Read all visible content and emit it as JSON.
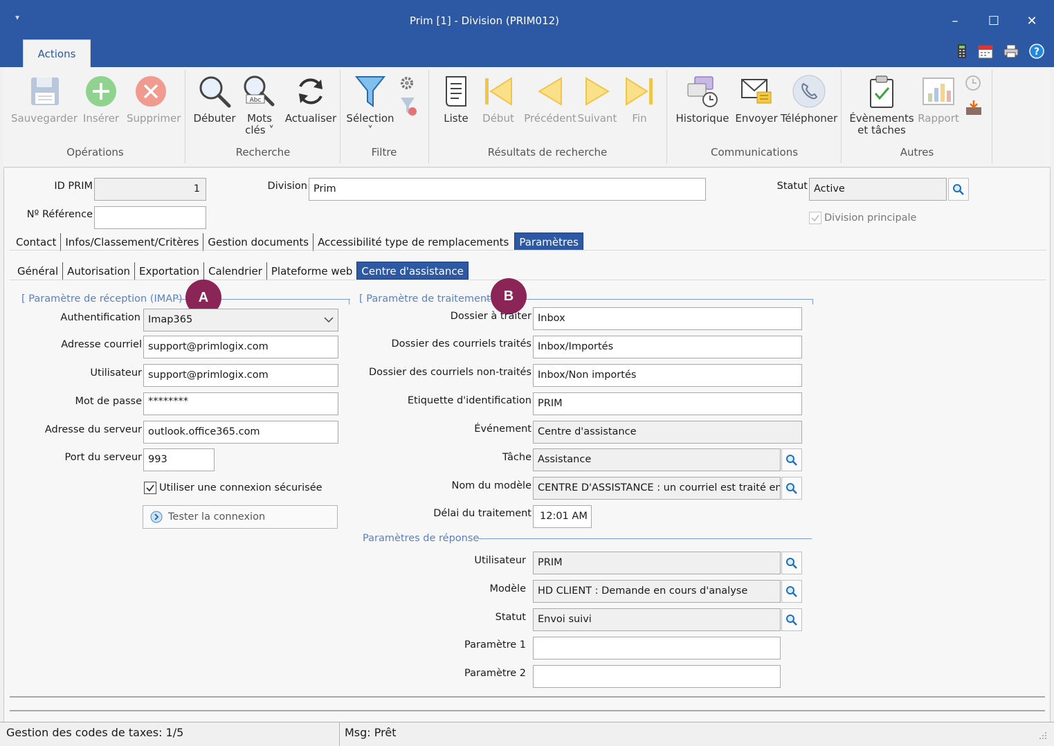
{
  "window": {
    "title": "Prim [1] - Division (PRIM012)",
    "minimize": "–",
    "maximize": "☐",
    "close": "✕"
  },
  "ribbon": {
    "tab": "Actions",
    "groups": {
      "operations": "Opérations",
      "recherche": "Recherche",
      "filtre": "Filtre",
      "resultats": "Résultats de recherche",
      "communications": "Communications",
      "autres": "Autres"
    },
    "buttons": {
      "sauvegarder": "Sauvegarder",
      "inserer": "Insérer",
      "supprimer": "Supprimer",
      "debuter": "Débuter",
      "mots_cles_1": "Mots",
      "mots_cles_2": "clés ˅",
      "actualiser": "Actualiser",
      "selection": "Sélection",
      "selection_arrow": "˅",
      "liste": "Liste",
      "debut": "Début",
      "precedent": "Précédent",
      "suivant": "Suivant",
      "fin": "Fin",
      "historique": "Historique",
      "envoyer": "Envoyer",
      "telephoner": "Téléphoner",
      "evenements_1": "Évènements",
      "evenements_2": "et tâches",
      "rapport": "Rapport"
    }
  },
  "header_fields": {
    "id_prim_label": "ID PRIM",
    "id_prim_value": "1",
    "division_label": "Division",
    "division_value": "Prim",
    "statut_label": "Statut",
    "statut_value": "Active",
    "reference_label": "Nº Référence",
    "reference_value": "",
    "division_principale_label": "Division principale"
  },
  "main_tabs": [
    "Contact",
    "Infos/Classement/Critères",
    "Gestion documents",
    "Accessibilité type de remplacements",
    "Paramètres"
  ],
  "sub_tabs": [
    "Général",
    "Autorisation",
    "Exportation",
    "Calendrier",
    "Plateforme web",
    "Centre d'assistance"
  ],
  "imap": {
    "section_title": "Paramètre de réception (IMAP)",
    "badge": "A",
    "auth_label": "Authentification",
    "auth_value": "Imap365",
    "email_label": "Adresse courriel",
    "email_value": "support@primlogix.com",
    "user_label": "Utilisateur",
    "user_value": "support@primlogix.com",
    "password_label": "Mot de passe",
    "password_value": "********",
    "server_label": "Adresse du serveur",
    "server_value": "outlook.office365.com",
    "port_label": "Port du serveur",
    "port_value": "993",
    "secure_label": "Utiliser une connexion sécurisée",
    "test_button": "Tester la connexion"
  },
  "traitement": {
    "section_title": "Paramètre de traitement",
    "badge": "B",
    "folder_label": "Dossier à traiter",
    "folder_value": "Inbox",
    "processed_label": "Dossier des courriels traités",
    "processed_value": "Inbox/Importés",
    "unprocessed_label": "Dossier des courriels non-traités",
    "unprocessed_value": "Inbox/Non importés",
    "tag_label": "Etiquette d'identification",
    "tag_value": "PRIM",
    "event_label": "Événement",
    "event_value": "Centre d'assistance",
    "task_label": "Tâche",
    "task_value": "Assistance",
    "template_label": "Nom du modèle",
    "template_value": "CENTRE D'ASSISTANCE : un courriel est traité en d",
    "delay_label": "Délai du traitement",
    "delay_value": "12:01 AM"
  },
  "reponse": {
    "section_title": "Paramètres de réponse",
    "user_label": "Utilisateur",
    "user_value": "PRIM",
    "model_label": "Modèle",
    "model_value": "HD CLIENT : Demande en cours d'analyse",
    "status_label": "Statut",
    "status_value": "Envoi suivi",
    "param1_label": "Paramètre 1",
    "param1_value": "",
    "param2_label": "Paramètre 2",
    "param2_value": ""
  },
  "statusbar": {
    "left": "Gestion des codes de taxes: 1/5",
    "right": "Msg: Prêt"
  },
  "colors": {
    "accent": "#2c58a4",
    "badge": "#8c2557",
    "section": "#5b7fc0"
  }
}
